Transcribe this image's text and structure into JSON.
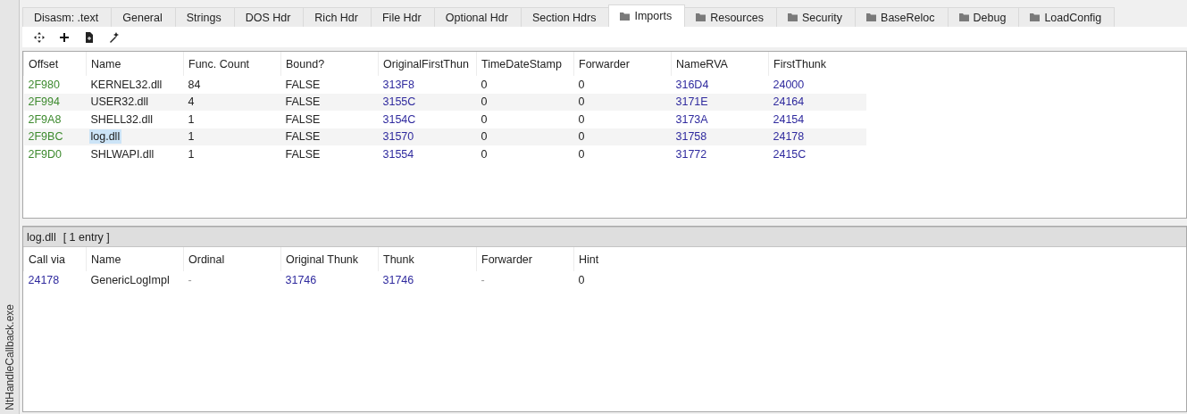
{
  "side_label": "NtHandleCallback.exe",
  "tabs": [
    {
      "label": "Disasm: .text",
      "kind": "plain",
      "selected": false
    },
    {
      "label": "General",
      "kind": "plain",
      "selected": false
    },
    {
      "label": "Strings",
      "kind": "plain",
      "selected": false
    },
    {
      "label": "DOS Hdr",
      "kind": "plain",
      "selected": false
    },
    {
      "label": "Rich Hdr",
      "kind": "plain",
      "selected": false
    },
    {
      "label": "File Hdr",
      "kind": "plain",
      "selected": false
    },
    {
      "label": "Optional Hdr",
      "kind": "plain",
      "selected": false
    },
    {
      "label": "Section Hdrs",
      "kind": "plain",
      "selected": false
    },
    {
      "label": "Imports",
      "kind": "folder",
      "selected": true
    },
    {
      "label": "Resources",
      "kind": "folder",
      "selected": false
    },
    {
      "label": "Security",
      "kind": "folder",
      "selected": false
    },
    {
      "label": "BaseReloc",
      "kind": "folder",
      "selected": false
    },
    {
      "label": "Debug",
      "kind": "folder",
      "selected": false
    },
    {
      "label": "LoadConfig",
      "kind": "folder",
      "selected": false
    }
  ],
  "imports_table": {
    "columns": [
      {
        "label": "Offset",
        "kind": "offset"
      },
      {
        "label": "Name",
        "kind": "plain"
      },
      {
        "label": "Func. Count",
        "kind": "plain"
      },
      {
        "label": "Bound?",
        "kind": "plain"
      },
      {
        "label": "OriginalFirstThun",
        "kind": "rva"
      },
      {
        "label": "TimeDateStamp",
        "kind": "plain"
      },
      {
        "label": "Forwarder",
        "kind": "plain"
      },
      {
        "label": "NameRVA",
        "kind": "rva"
      },
      {
        "label": "FirstThunk",
        "kind": "rva"
      }
    ],
    "rows": [
      {
        "selected": false,
        "cells": [
          "2F980",
          "KERNEL32.dll",
          "84",
          "FALSE",
          "313F8",
          "0",
          "0",
          "316D4",
          "24000"
        ]
      },
      {
        "selected": false,
        "cells": [
          "2F994",
          "USER32.dll",
          "4",
          "FALSE",
          "3155C",
          "0",
          "0",
          "3171E",
          "24164"
        ]
      },
      {
        "selected": false,
        "cells": [
          "2F9A8",
          "SHELL32.dll",
          "1",
          "FALSE",
          "3154C",
          "0",
          "0",
          "3173A",
          "24154"
        ]
      },
      {
        "selected": true,
        "cells": [
          "2F9BC",
          "log.dll",
          "1",
          "FALSE",
          "31570",
          "0",
          "0",
          "31758",
          "24178"
        ]
      },
      {
        "selected": false,
        "cells": [
          "2F9D0",
          "SHLWAPI.dll",
          "1",
          "FALSE",
          "31554",
          "0",
          "0",
          "31772",
          "2415C"
        ]
      }
    ]
  },
  "detail_bar": {
    "name": "log.dll",
    "count": "[ 1 entry ]"
  },
  "functions_table": {
    "columns": [
      {
        "label": "Call via",
        "kind": "rva"
      },
      {
        "label": "Name",
        "kind": "plain"
      },
      {
        "label": "Ordinal",
        "kind": "dim"
      },
      {
        "label": "Original Thunk",
        "kind": "rva"
      },
      {
        "label": "Thunk",
        "kind": "rva"
      },
      {
        "label": "Forwarder",
        "kind": "dim"
      },
      {
        "label": "Hint",
        "kind": "plain"
      }
    ],
    "rows": [
      {
        "selected": false,
        "cells": [
          "24178",
          "GenericLogImpl",
          "-",
          "31746",
          "31746",
          "-",
          "0"
        ]
      }
    ]
  }
}
